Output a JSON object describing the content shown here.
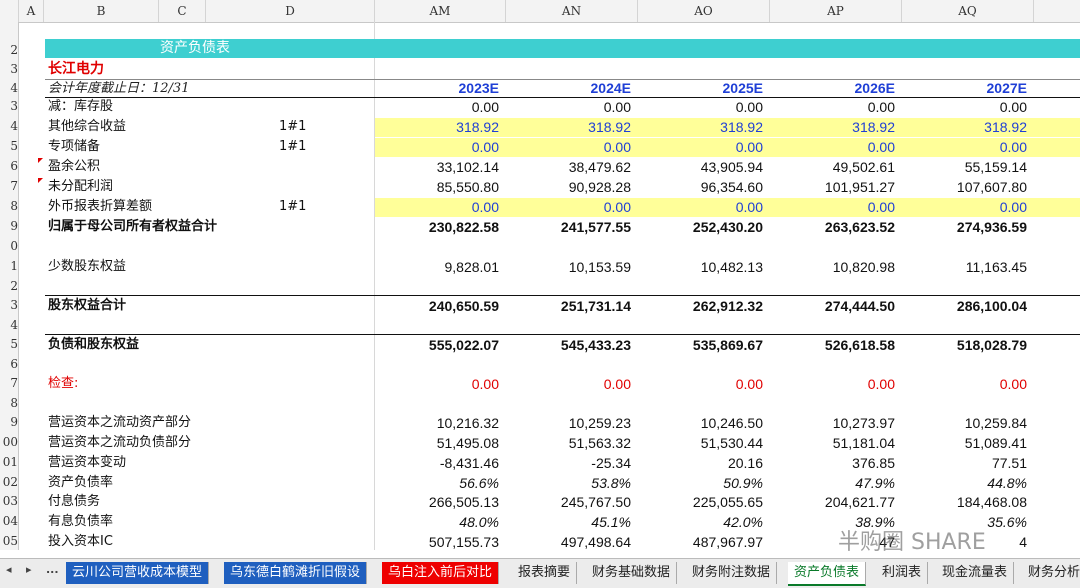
{
  "columns": {
    "A": "A",
    "B": "B",
    "C": "C",
    "D": "D",
    "AM": "AM",
    "AN": "AN",
    "AO": "AO",
    "AP": "AP",
    "AQ": "AQ"
  },
  "row_numbers": [
    "",
    "2",
    "3",
    "4",
    "3",
    "4",
    "5",
    "6",
    "7",
    "8",
    "9",
    "0",
    "1",
    "2",
    "3",
    "4",
    "5",
    "6",
    "7",
    "8",
    "9",
    "00",
    "01",
    "02",
    "03",
    "04",
    "05"
  ],
  "sheet": {
    "title": "资产负债表",
    "company": "长江电力",
    "fy_label": "会计年度截止日：12/31",
    "years": [
      "2023E",
      "2024E",
      "2025E",
      "2026E",
      "2027E"
    ]
  },
  "rows": [
    {
      "label": "减：库存股",
      "mark": "",
      "values": [
        "0.00",
        "0.00",
        "0.00",
        "0.00",
        "0.00"
      ]
    },
    {
      "label": "其他综合收益",
      "mark": "1#1",
      "values": [
        "318.92",
        "318.92",
        "318.92",
        "318.92",
        "318.92"
      ]
    },
    {
      "label": "专项储备",
      "mark": "1#1",
      "values": [
        "0.00",
        "0.00",
        "0.00",
        "0.00",
        "0.00"
      ]
    },
    {
      "label": "盈余公积",
      "mark": "",
      "values": [
        "33,102.14",
        "38,479.62",
        "43,905.94",
        "49,502.61",
        "55,159.14"
      ]
    },
    {
      "label": "未分配利润",
      "mark": "",
      "values": [
        "85,550.80",
        "90,928.28",
        "96,354.60",
        "101,951.27",
        "107,607.80"
      ]
    },
    {
      "label": "外币报表折算差额",
      "mark": "1#1",
      "values": [
        "0.00",
        "0.00",
        "0.00",
        "0.00",
        "0.00"
      ]
    },
    {
      "label": "归属于母公司所有者权益合计",
      "mark": "",
      "values": [
        "230,822.58",
        "241,577.55",
        "252,430.20",
        "263,623.52",
        "274,936.59"
      ]
    },
    {
      "label": "少数股东权益",
      "mark": "",
      "values": [
        "9,828.01",
        "10,153.59",
        "10,482.13",
        "10,820.98",
        "11,163.45"
      ]
    },
    {
      "label": "股东权益合计",
      "mark": "",
      "values": [
        "240,650.59",
        "251,731.14",
        "262,912.32",
        "274,444.50",
        "286,100.04"
      ]
    },
    {
      "label": "负债和股东权益",
      "mark": "",
      "values": [
        "555,022.07",
        "545,433.23",
        "535,869.67",
        "526,618.58",
        "518,028.79"
      ]
    },
    {
      "label": "检查:",
      "mark": "",
      "values": [
        "0.00",
        "0.00",
        "0.00",
        "0.00",
        "0.00"
      ]
    },
    {
      "label": "营运资本之流动资产部分",
      "mark": "",
      "values": [
        "10,216.32",
        "10,259.23",
        "10,246.50",
        "10,273.97",
        "10,259.84"
      ]
    },
    {
      "label": "营运资本之流动负债部分",
      "mark": "",
      "values": [
        "51,495.08",
        "51,563.32",
        "51,530.44",
        "51,181.04",
        "51,089.41"
      ]
    },
    {
      "label": "营运资本变动",
      "mark": "",
      "values": [
        "-8,431.46",
        "-25.34",
        "20.16",
        "376.85",
        "77.51"
      ]
    },
    {
      "label": "资产负债率",
      "mark": "",
      "values": [
        "56.6%",
        "53.8%",
        "50.9%",
        "47.9%",
        "44.8%"
      ]
    },
    {
      "label": "付息债务",
      "mark": "",
      "values": [
        "266,505.13",
        "245,767.50",
        "225,055.65",
        "204,621.77",
        "184,468.08"
      ]
    },
    {
      "label": "有息负债率",
      "mark": "",
      "values": [
        "48.0%",
        "45.1%",
        "42.0%",
        "38.9%",
        "35.6%"
      ]
    },
    {
      "label": "投入资本IC",
      "mark": "",
      "values": [
        "507,155.73",
        "497,498.64",
        "487,967.97",
        "47",
        "4"
      ]
    }
  ],
  "tabs": {
    "nav": [
      "◂",
      "▸",
      "..."
    ],
    "items": [
      "云川公司营收成本模型",
      "乌东德白鹤滩折旧假设",
      "乌白注入前后对比",
      "报表摘要",
      "财务基础数据",
      "财务附注数据",
      "资产负债表",
      "利润表",
      "现金流量表",
      "财务分析"
    ]
  },
  "watermark": "半购圈 SHARE",
  "colors": {
    "title_band": "#3ecfd0",
    "yellow_fill": "#ffff99",
    "year_blue": "#1f3fd6",
    "check_red": "#e00000",
    "active_tab": "#0a7a2a"
  }
}
